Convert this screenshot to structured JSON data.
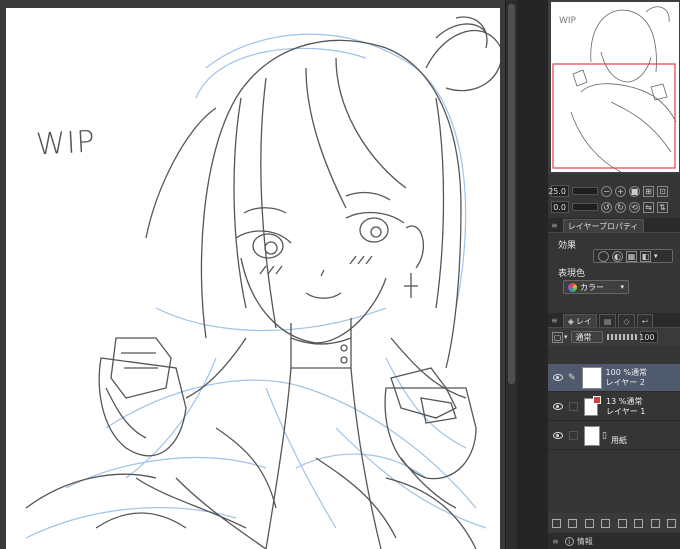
{
  "canvas": {
    "wip_text": "WIP"
  },
  "navigator": {
    "wip_text": "WIP"
  },
  "navigator_controls": {
    "zoom_value": "25.0",
    "rotate_value": "0.0"
  },
  "layer_property": {
    "tab_label": "レイヤープロパティ",
    "effect_label": "効果",
    "color_label": "表現色",
    "color_value": "カラー"
  },
  "layer_panel": {
    "tab_layer": "レイ",
    "blend_mode": "通常",
    "opacity": "100"
  },
  "layers": [
    {
      "mode": "100 %通常",
      "name": "レイヤー 2",
      "selected": true
    },
    {
      "mode": "13 %通常",
      "name": "レイヤー 1",
      "selected": false
    },
    {
      "mode": "",
      "name": "用紙",
      "selected": false
    }
  ],
  "status": {
    "info_label": "情報"
  },
  "colors": {
    "red_frame": "#e04040",
    "sketch_blue": "#9fc3e6",
    "sketch_gray": "#555555"
  }
}
